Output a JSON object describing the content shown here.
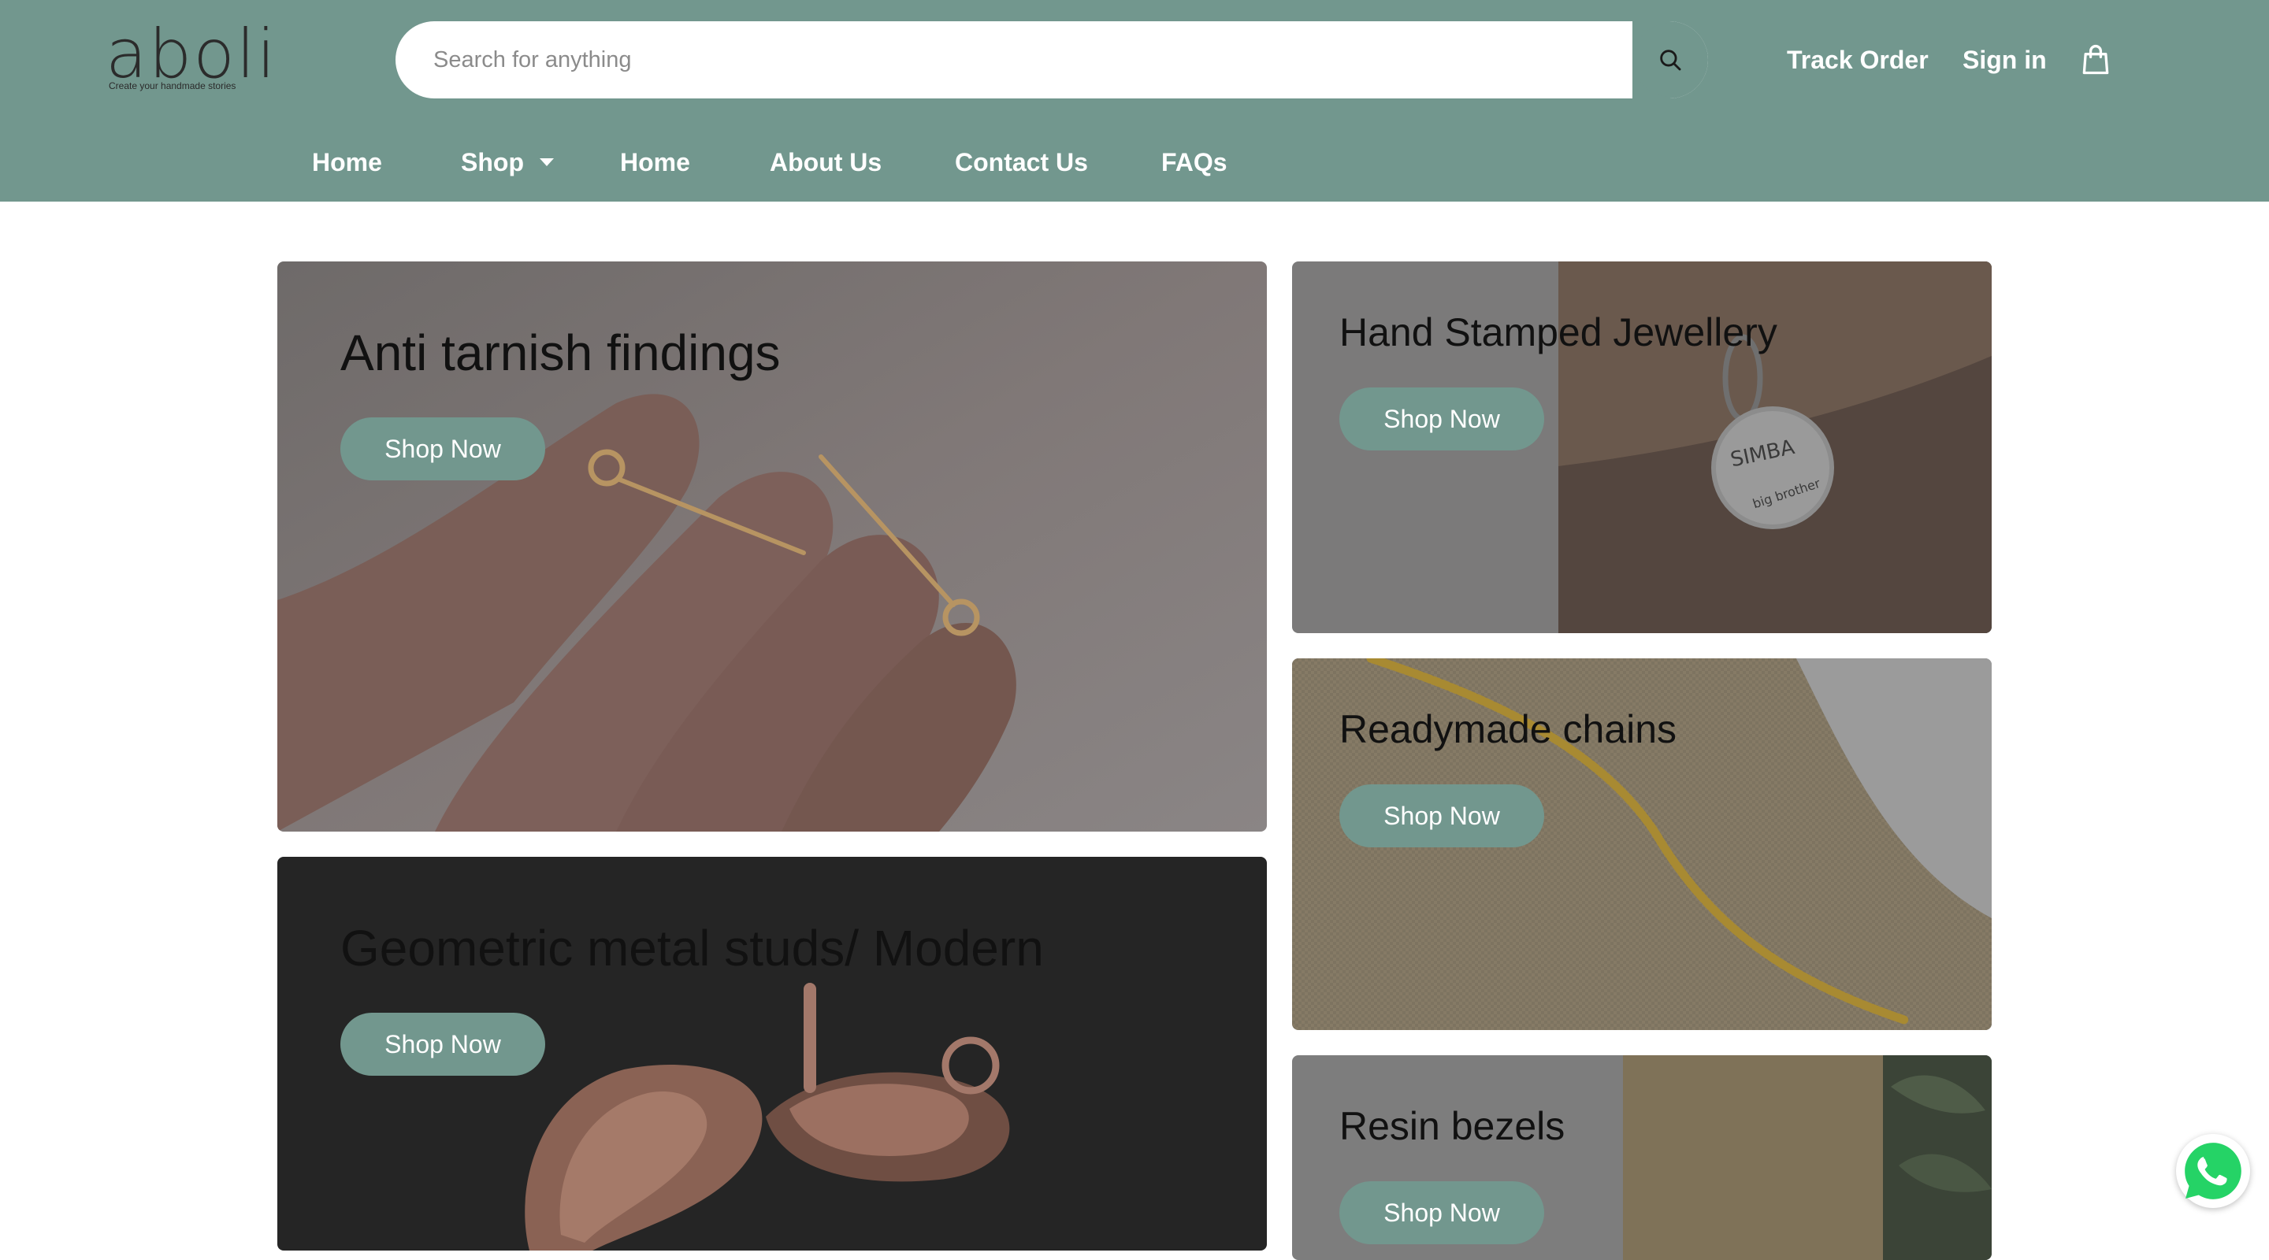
{
  "header": {
    "logo": {
      "text": "aboli",
      "tagline": "Create your handmade stories"
    },
    "search": {
      "placeholder": "Search for anything",
      "value": "",
      "icon": "search-icon"
    },
    "links": {
      "track_order": "Track Order",
      "sign_in": "Sign in"
    },
    "cart_icon": "shopping-bag-icon",
    "background": "#72978e"
  },
  "nav": {
    "items": [
      {
        "label": "Home"
      },
      {
        "label": "Shop",
        "has_dropdown": true
      },
      {
        "label": "Home"
      },
      {
        "label": "About Us"
      },
      {
        "label": "Contact Us"
      },
      {
        "label": "FAQs"
      }
    ]
  },
  "banners": [
    {
      "title": "Anti tarnish findings",
      "button": "Shop Now",
      "image": "hand holding gold eye pins"
    },
    {
      "title": "Geometric metal studs/ Modern",
      "button": "Shop Now",
      "image": "rose gold teardrop earring studs"
    },
    {
      "title": "Hand Stamped Jewellery",
      "button": "Shop Now",
      "image": "stamped round pet tag on wood"
    },
    {
      "title": "Readymade chains",
      "button": "Shop Now",
      "image": "gold chain on burlap"
    },
    {
      "title": "Resin bezels",
      "button": "Shop Now",
      "image": "bezel on kraft paper with leaves"
    }
  ],
  "floating": {
    "whatsapp_icon": "whatsapp-icon"
  },
  "colors": {
    "accent": "#72978e",
    "button_text": "#ffffff",
    "title_text": "#111111"
  }
}
